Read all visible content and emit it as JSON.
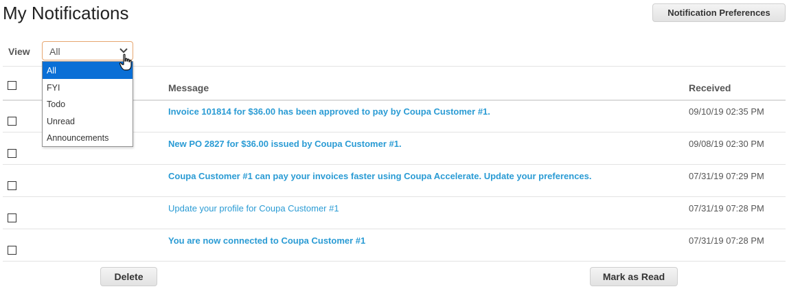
{
  "page_title": "My Notifications",
  "prefs_button": "Notification Preferences",
  "view": {
    "label": "View",
    "selected": "All",
    "options": [
      "All",
      "FYI",
      "Todo",
      "Unread",
      "Announcements"
    ]
  },
  "table": {
    "columns": {
      "message": "Message",
      "received": "Received"
    },
    "rows": [
      {
        "message": "Invoice 101814 for $36.00 has been approved to pay by Coupa Customer #1.",
        "received": "09/10/19 02:35 PM",
        "unread": true
      },
      {
        "message": "New PO 2827 for $36.00 issued by Coupa Customer #1.",
        "received": "09/08/19 02:30 PM",
        "unread": true
      },
      {
        "message": "Coupa Customer #1 can pay your invoices faster using Coupa Accelerate. Update your preferences.",
        "received": "07/31/19 07:29 PM",
        "unread": true
      },
      {
        "message": "Update your profile for Coupa Customer #1",
        "received": "07/31/19 07:28 PM",
        "unread": false
      },
      {
        "message": "You are now connected to Coupa Customer #1",
        "received": "07/31/19 07:28 PM",
        "unread": true
      }
    ]
  },
  "footer": {
    "delete": "Delete",
    "mark_read": "Mark as Read"
  },
  "colors": {
    "link": "#2a9bd4",
    "selected_option": "#0a6fd6",
    "select_border": "#e6a56f"
  },
  "icons": {
    "select_arrow": "chevron-down-icon",
    "cursor": "hand-pointer-icon"
  }
}
